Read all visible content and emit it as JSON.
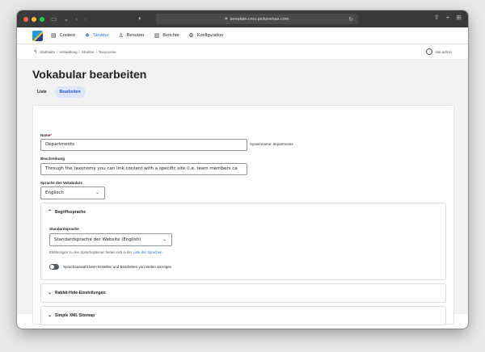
{
  "browser": {
    "url": "template.cms.picturemax.com"
  },
  "toolbar": {
    "items": [
      {
        "label": "Content",
        "icon": "document-icon"
      },
      {
        "label": "Struktur",
        "icon": "structure-icon",
        "active": true
      },
      {
        "label": "Benutzer",
        "icon": "user-icon"
      },
      {
        "label": "Berichte",
        "icon": "chart-icon"
      },
      {
        "label": "Konfiguration",
        "icon": "gear-icon"
      }
    ]
  },
  "breadcrumb": {
    "items": [
      "Startseite",
      "Verwaltung",
      "Struktur",
      "Taxonomie"
    ],
    "separator": "/",
    "user": "site.admin"
  },
  "page": {
    "title": "Vokabular bearbeiten",
    "tabs": [
      {
        "label": "Liste",
        "active": false
      },
      {
        "label": "Bearbeiten",
        "active": true
      }
    ]
  },
  "form": {
    "name_label": "Name",
    "required_mark": "*",
    "name_value": "Departments",
    "machine_name": "Systemname: departments",
    "description_label": "Beschreibung",
    "description_value": "Through the taxonomy you can link content with a specific site (i.e. team members ca",
    "language_label": "Sprache des Vokabulars",
    "language_value": "Englisch",
    "term_language": {
      "title": "Begriffssprache",
      "default_label": "Standardsprache",
      "default_value": "Standardsprache der Website (English)",
      "hint_text": "Erklärungen zu den Sprachoptionen finden sich in der",
      "hint_link": "Liste der Sprachen.",
      "toggle_label": "Sprachauswahl beim Erstellen und Bearbeiten von Seiten anzeigen"
    },
    "rabbit_hole": "Rabbit-Hole-Einstellungen",
    "sitemap": "Simple XML Sitemap"
  },
  "colors": {
    "accent": "#2b6cd8",
    "active_tab_bg": "#dce6fb",
    "required": "#d72222"
  }
}
